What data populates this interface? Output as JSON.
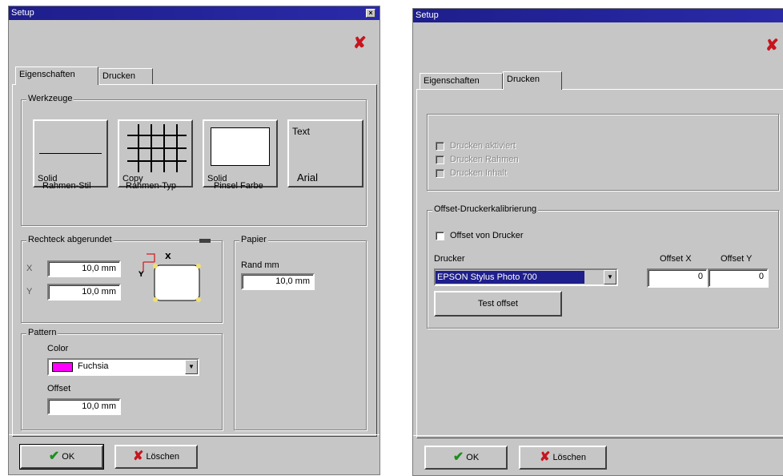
{
  "left": {
    "title": "Setup",
    "title_close": "×",
    "delete_glyph": "✘",
    "tabs": [
      "Eigenschaften",
      "Drucken"
    ],
    "werkzeuge": {
      "legend": "Werkzeuge",
      "tools": [
        {
          "caption": "Solid",
          "label": "Rahmen-Stil"
        },
        {
          "caption": "Copy",
          "label": "Rahmen-Typ"
        },
        {
          "caption": "Solid",
          "label": "Pinsel Farbe"
        },
        {
          "text": "Text",
          "caption": "Arial"
        }
      ]
    },
    "rechteck": {
      "legend": "Rechteck abgerundet",
      "x_label": "X",
      "x_value": "10,0 mm",
      "y_label": "Y",
      "y_value": "10,0 mm",
      "axis_x": "X",
      "axis_y": "Y"
    },
    "pattern": {
      "legend": "Pattern",
      "color_label": "Color",
      "color_value": "Fuchsia",
      "color_swatch": "#ff00ff",
      "offset_label": "Offset",
      "offset_value": "10,0 mm"
    },
    "papier": {
      "legend": "Papier",
      "rand_label": "Rand mm",
      "rand_value": "10,0 mm"
    },
    "ok_label": "OK",
    "loeschen_label": "Löschen"
  },
  "right": {
    "title": "Setup",
    "title_close": "×",
    "delete_glyph": "✘",
    "tabs": [
      "Eigenschaften",
      "Drucken"
    ],
    "disabled_checks": [
      "Drucken aktiviert",
      "Drucken Rahmen",
      "Drucken Inhalt"
    ],
    "offset_group": {
      "legend": "Offset-Druckerkalibrierung",
      "checkbox_label": "Offset von Drucker",
      "drucker_label": "Drucker",
      "offset_x_label": "Offset X",
      "offset_y_label": "Offset Y",
      "printer_value": "EPSON Stylus Photo 700",
      "offset_x_value": "0",
      "offset_y_value": "0",
      "test_button": "Test offset"
    },
    "ok_label": "OK",
    "loeschen_label": "Löschen"
  }
}
